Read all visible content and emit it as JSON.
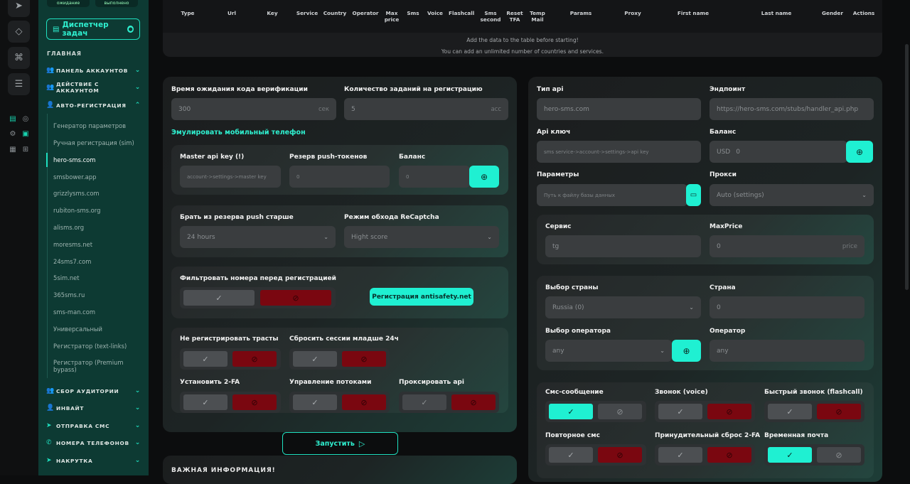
{
  "sidebar": {
    "top_tabs": [
      "ожидание",
      "выполнено"
    ],
    "dispatcher_label": "Диспетчер задач",
    "section_main": "ГЛАВНАЯ",
    "groups": [
      {
        "label": "ПАНЕЛЬ АККАУНТОВ"
      },
      {
        "label": "ДЕЙСТВИЕ С АККАУНТОМ"
      },
      {
        "label": "АВТО-РЕГИСТРАЦИЯ"
      },
      {
        "label": "СБОР АУДИТОРИИ"
      },
      {
        "label": "ИНВАЙТ"
      },
      {
        "label": "ОТПРАВКА СМС"
      },
      {
        "label": "НОМЕРА ТЕЛЕФОНОВ"
      },
      {
        "label": "НАКРУТКА"
      }
    ],
    "items": [
      "Генератор параметров",
      "Ручная регистрация (sim)",
      "hero-sms.com",
      "smsbower.app",
      "grizzlysms.com",
      "rubiton-sms.org",
      "alisms.org",
      "moresms.net",
      "24sms7.com",
      "5sim.net",
      "365sms.ru",
      "sms-man.com",
      "Универсальный",
      "Регистратор (text-links)",
      "Регистратор (Premium bypass)"
    ]
  },
  "table": {
    "headers": [
      "Type",
      "Url",
      "Key",
      "Service",
      "Country",
      "Operator",
      "Max price",
      "Sms",
      "Voice",
      "Flashcall",
      "Sms second",
      "Reset TFA",
      "Temp Mail",
      "Params",
      "Proxy",
      "First name",
      "Last name",
      "Gender",
      "Actions"
    ],
    "note1": "Add the data to the table before starting!",
    "note2": "You can add an unlimited number of countries and services."
  },
  "left": {
    "verify_wait_label": "Время ожидания кода верификации",
    "verify_wait_value": "300",
    "verify_wait_unit": "сек",
    "tasks_label": "Количество заданий на регистрацию",
    "tasks_value": "5",
    "tasks_unit": "acc",
    "emulate_link": "Эмулировать мобильный телефон",
    "master_key_label": "Master api key (!)",
    "master_key_placeholder": "account->settings->master key",
    "push_reserve_label": "Резерв push-токенов",
    "push_reserve_value": "0",
    "balance_label": "Баланс",
    "balance_value": "0",
    "push_older_label": "Брать из резерва push старше",
    "push_older_value": "24 hours",
    "recaptcha_label": "Режим обхода ReCaptcha",
    "recaptcha_value": "Hight score",
    "filter_label": "Фильтровать номера перед регистрацией",
    "antisafety_button": "Регистрация antisafety.net",
    "no_trusts_label": "Не регистрировать трасты",
    "reset_sessions_label": "Сбросить сессии младше 24ч",
    "set_2fa_label": "Установить 2-FA",
    "threads_label": "Управление потоками",
    "proxy_api_label": "Проксировать api",
    "start_button": "Запустить",
    "info_title": "ВАЖНАЯ ИНФОРМАЦИЯ!"
  },
  "right": {
    "api_type_label": "Тип api",
    "api_type_value": "hero-sms.com",
    "endpoint_label": "Эндпоинт",
    "endpoint_value": "https://hero-sms.com/stubs/handler_api.php",
    "api_key_label": "Api ключ",
    "api_key_placeholder": "sms service->account->settings->api key",
    "balance_label": "Баланс",
    "balance_currency": "USD",
    "balance_value": "0",
    "params_label": "Параметры",
    "params_placeholder": "Путь к файлу базы данных",
    "proxy_label": "Прокси",
    "proxy_value": "Auto (settings)",
    "service_label": "Сервис",
    "service_value": "tg",
    "maxprice_label": "MaxPrice",
    "maxprice_value": "0",
    "maxprice_unit": "price",
    "country_select_label": "Выбор страны",
    "country_select_value": "Russia (0)",
    "country_label": "Страна",
    "country_value": "0",
    "operator_select_label": "Выбор оператора",
    "operator_select_value": "any",
    "operator_label": "Оператор",
    "operator_value": "any",
    "sms_label": "Смс-сообщение",
    "voice_label": "Звонок (voice)",
    "flashcall_label": "Быстрый звонок (flashcall)",
    "repeat_sms_label": "Повторное смс",
    "force_reset_label": "Принудительный сброс 2-FA",
    "temp_mail_label": "Временная почта"
  },
  "colors": {
    "accent": "#1ff0d2",
    "danger": "#7a0710",
    "panel": "#1b1d1e",
    "sidebar": "#0d3a33"
  }
}
